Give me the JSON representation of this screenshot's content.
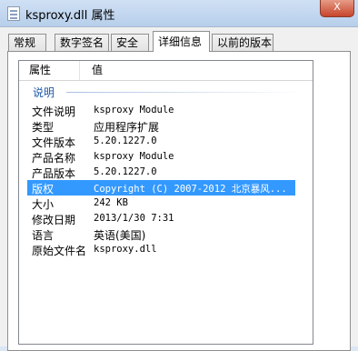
{
  "window": {
    "title": "ksproxy.dll 属性",
    "close_label": "X"
  },
  "tabs": [
    {
      "label": "常规"
    },
    {
      "label": "数字签名"
    },
    {
      "label": "安全"
    },
    {
      "label": "详细信息",
      "active": true
    },
    {
      "label": "以前的版本"
    }
  ],
  "details": {
    "columns": {
      "property": "属性",
      "value": "值"
    },
    "group_label": "说明",
    "rows": [
      {
        "name": "文件说明",
        "value": "ksproxy Module"
      },
      {
        "name": "类型",
        "value": "应用程序扩展"
      },
      {
        "name": "文件版本",
        "value": "5.20.1227.0"
      },
      {
        "name": "产品名称",
        "value": "ksproxy Module"
      },
      {
        "name": "产品版本",
        "value": "5.20.1227.0"
      },
      {
        "name": "版权",
        "value": "Copyright (C) 2007-2012 北京暴风...",
        "selected": true
      },
      {
        "name": "大小",
        "value": "242 KB"
      },
      {
        "name": "修改日期",
        "value": "2013/1/30 7:31"
      },
      {
        "name": "语言",
        "value": "英语(美国)"
      },
      {
        "name": "原始文件名",
        "value": "ksproxy.dll"
      }
    ]
  },
  "colors": {
    "selection": "#3399ff",
    "group_label": "#1e57a8"
  }
}
